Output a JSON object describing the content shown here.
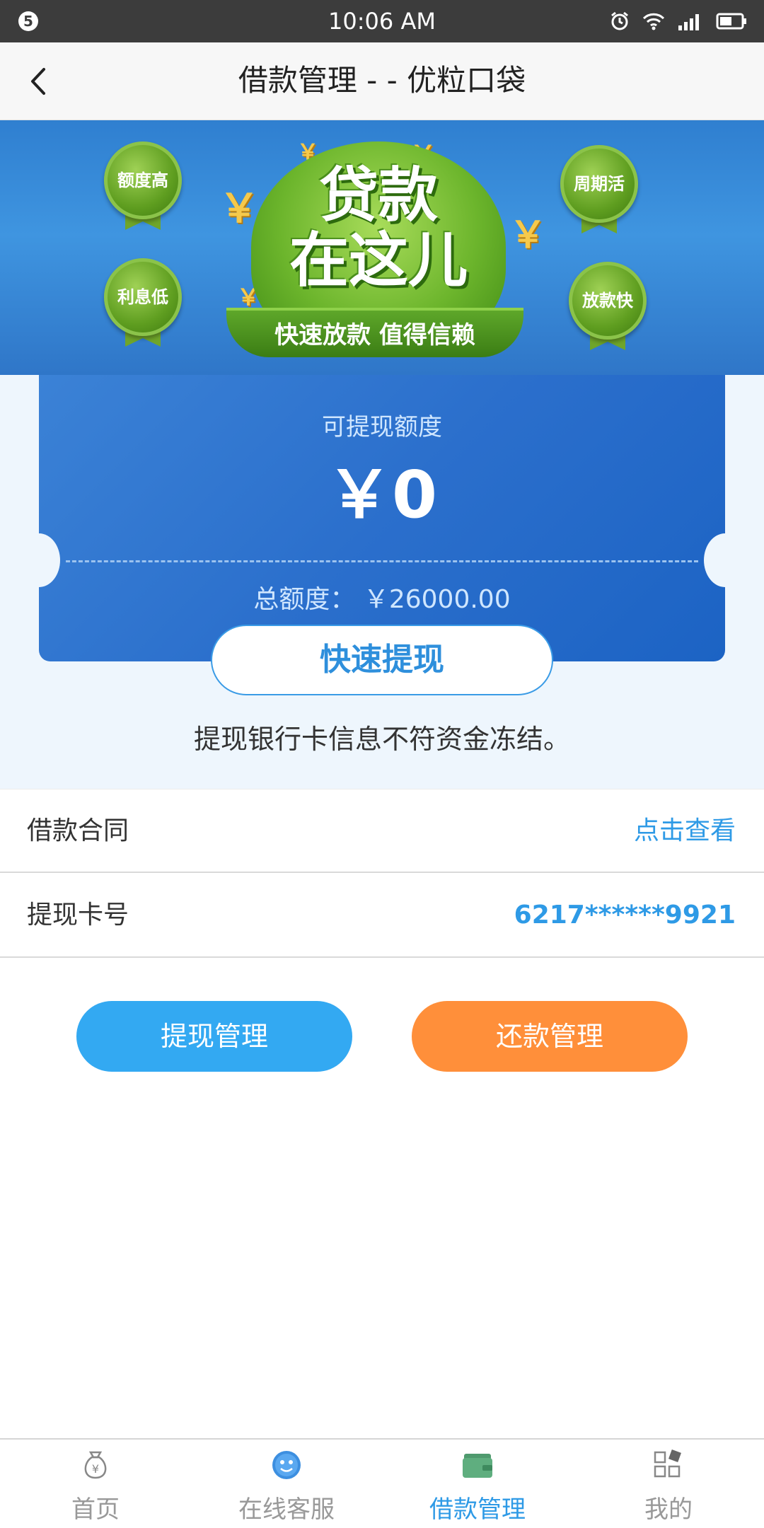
{
  "status_bar": {
    "notification_count": "5",
    "time": "10:06 AM"
  },
  "header": {
    "title": "借款管理 - - 优粒口袋"
  },
  "banner": {
    "headline": "贷款在这儿",
    "headline_line1": "贷款",
    "headline_line2": "在这儿",
    "ribbon": "快速放款 值得信赖",
    "badges": [
      "额度高",
      "利息低",
      "周期活",
      "放款快"
    ]
  },
  "card": {
    "available_label": "可提现额度",
    "available_amount": "￥0",
    "total_label": "总额度：",
    "total_amount": "￥26000.00"
  },
  "withdraw_button": "快速提现",
  "notice": "提现银行卡信息不符资金冻结。",
  "rows": [
    {
      "label": "借款合同",
      "value": "点击查看"
    },
    {
      "label": "提现卡号",
      "value": "6217******9921"
    }
  ],
  "actions": {
    "withdraw_manage": "提现管理",
    "repay_manage": "还款管理"
  },
  "tabbar": {
    "items": [
      {
        "label": "首页",
        "icon": "money-bag-icon"
      },
      {
        "label": "在线客服",
        "icon": "customer-service-icon"
      },
      {
        "label": "借款管理",
        "icon": "wallet-icon"
      },
      {
        "label": "我的",
        "icon": "grid-apps-icon"
      }
    ],
    "active_index": 2
  },
  "colors": {
    "accent": "#2e9ae6",
    "orange": "#ff8f3a",
    "card_blue": "#2b6fcc"
  }
}
